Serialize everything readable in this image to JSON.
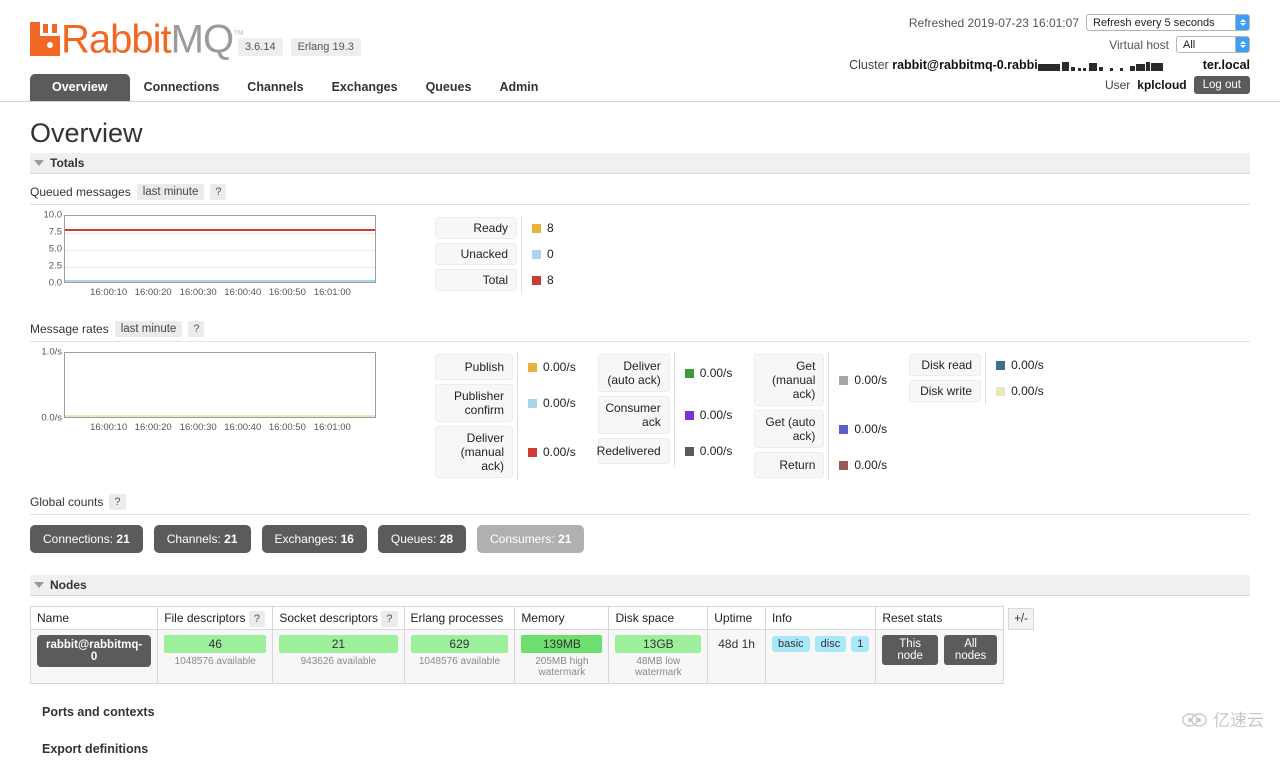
{
  "header": {
    "logo_text_primary": "Rabbit",
    "logo_text_secondary": "MQ",
    "logo_tm": "™",
    "version": "3.6.14",
    "erlang": "Erlang 19.3",
    "refreshed_label": "Refreshed 2019-07-23 16:01:07",
    "refresh_select_value": "Refresh every 5 seconds",
    "vhost_label": "Virtual host",
    "vhost_select_value": "All",
    "cluster_label": "Cluster",
    "cluster_name_prefix": "rabbit@rabbitmq-0.rabbi",
    "cluster_name_suffix": "ter.local",
    "user_label": "User",
    "user_name": "kplcloud",
    "logout_label": "Log out"
  },
  "nav": {
    "tabs": [
      {
        "label": "Overview",
        "active": true
      },
      {
        "label": "Connections",
        "active": false
      },
      {
        "label": "Channels",
        "active": false
      },
      {
        "label": "Exchanges",
        "active": false
      },
      {
        "label": "Queues",
        "active": false
      },
      {
        "label": "Admin",
        "active": false
      }
    ]
  },
  "page": {
    "title": "Overview",
    "totals_section_label": "Totals",
    "nodes_section_label": "Nodes",
    "ports_section_label": "Ports and contexts",
    "export_section_label": "Export definitions"
  },
  "queued_messages": {
    "title": "Queued messages",
    "range_chip": "last minute",
    "help": "?",
    "legend": [
      {
        "label": "Ready",
        "value": "8",
        "color": "#e5b53a"
      },
      {
        "label": "Unacked",
        "value": "0",
        "color": "#a8d6ec"
      },
      {
        "label": "Total",
        "value": "8",
        "color": "#cc3b36"
      }
    ]
  },
  "message_rates": {
    "title": "Message rates",
    "range_chip": "last minute",
    "help": "?",
    "columns": [
      {
        "items": [
          {
            "label": "Publish",
            "value": "0.00/s",
            "color": "#e5b53a"
          },
          {
            "label": "Publisher\nconfirm",
            "value": "0.00/s",
            "color": "#a8d6ec"
          },
          {
            "label": "Deliver\n(manual\nack)",
            "value": "0.00/s",
            "color": "#cc3b36"
          }
        ]
      },
      {
        "items": [
          {
            "label": "Deliver\n(auto ack)",
            "value": "0.00/s",
            "color": "#3c9a3c"
          },
          {
            "label": "Consumer\nack",
            "value": "0.00/s",
            "color": "#7b2fe0"
          },
          {
            "label": "Redelivered",
            "value": "0.00/s",
            "color": "#5a5a5a"
          }
        ]
      },
      {
        "items": [
          {
            "label": "Get\n(manual\nack)",
            "value": "0.00/s",
            "color": "#a7a7a7"
          },
          {
            "label": "Get (auto\nack)",
            "value": "0.00/s",
            "color": "#5b5fc7"
          },
          {
            "label": "Return",
            "value": "0.00/s",
            "color": "#9b5a56"
          }
        ]
      },
      {
        "items": [
          {
            "label": "Disk read",
            "value": "0.00/s",
            "color": "#3f6f8f"
          },
          {
            "label": "Disk write",
            "value": "0.00/s",
            "color": "#ece6bb"
          }
        ]
      }
    ]
  },
  "global_counts": {
    "title": "Global counts",
    "help": "?",
    "items": [
      {
        "label": "Connections:",
        "value": "21",
        "muted": false
      },
      {
        "label": "Channels:",
        "value": "21",
        "muted": false
      },
      {
        "label": "Exchanges:",
        "value": "16",
        "muted": false
      },
      {
        "label": "Queues:",
        "value": "28",
        "muted": false
      },
      {
        "label": "Consumers:",
        "value": "21",
        "muted": true
      }
    ]
  },
  "nodes": {
    "headers": [
      {
        "label": "Name",
        "help": ""
      },
      {
        "label": "File descriptors",
        "help": "?"
      },
      {
        "label": "Socket descriptors",
        "help": "?"
      },
      {
        "label": "Erlang processes",
        "help": ""
      },
      {
        "label": "Memory",
        "help": ""
      },
      {
        "label": "Disk space",
        "help": ""
      },
      {
        "label": "Uptime",
        "help": ""
      },
      {
        "label": "Info",
        "help": ""
      },
      {
        "label": "Reset stats",
        "help": ""
      }
    ],
    "toggle_columns_label": "+/-",
    "row": {
      "name": "rabbit@rabbitmq-0",
      "file_descriptors": {
        "value": "46",
        "note": "1048576 available"
      },
      "socket_descriptors": {
        "value": "21",
        "note": "943626 available"
      },
      "erlang_processes": {
        "value": "629",
        "note": "1048576 available"
      },
      "memory": {
        "value": "139MB",
        "note": "205MB high watermark"
      },
      "disk_space": {
        "value": "13GB",
        "note": "48MB low watermark"
      },
      "uptime": "48d 1h",
      "info_tags": [
        "basic",
        "disc",
        "1"
      ],
      "reset_buttons": [
        "This node",
        "All nodes"
      ]
    }
  },
  "watermark": {
    "text": "亿速云"
  },
  "chart_data": [
    {
      "type": "line",
      "title": "Queued messages",
      "xlabel": "",
      "ylabel": "",
      "ylim": [
        0,
        10
      ],
      "yticks": [
        0.0,
        2.5,
        5.0,
        7.5,
        10.0
      ],
      "ytick_labels": [
        "0.0",
        "2.5",
        "5.0",
        "7.5",
        "10.0"
      ],
      "xticks": [
        "16:00:10",
        "16:00:20",
        "16:00:30",
        "16:00:40",
        "16:00:50",
        "16:01:00"
      ],
      "grid": true,
      "legend_position": "right",
      "series": [
        {
          "name": "Ready",
          "color": "#e5b53a",
          "values": [
            8,
            8,
            8,
            8,
            8,
            8,
            8
          ]
        },
        {
          "name": "Unacked",
          "color": "#a8d6ec",
          "values": [
            0,
            0,
            0,
            0,
            0,
            0,
            0
          ]
        },
        {
          "name": "Total",
          "color": "#cc3b36",
          "values": [
            8,
            8,
            8,
            8,
            8,
            8,
            8
          ]
        }
      ]
    },
    {
      "type": "line",
      "title": "Message rates",
      "xlabel": "",
      "ylabel": "",
      "ylim": [
        0,
        1
      ],
      "yticks": [
        0.0,
        1.0
      ],
      "ytick_labels": [
        "0.0/s",
        "1.0/s"
      ],
      "xticks": [
        "16:00:10",
        "16:00:20",
        "16:00:30",
        "16:00:40",
        "16:00:50",
        "16:01:00"
      ],
      "grid": false,
      "legend_position": "right",
      "series": [
        {
          "name": "Publish",
          "color": "#e5b53a",
          "values": [
            0,
            0,
            0,
            0,
            0,
            0,
            0
          ]
        },
        {
          "name": "Publisher confirm",
          "color": "#a8d6ec",
          "values": [
            0,
            0,
            0,
            0,
            0,
            0,
            0
          ]
        },
        {
          "name": "Deliver (manual ack)",
          "color": "#cc3b36",
          "values": [
            0,
            0,
            0,
            0,
            0,
            0,
            0
          ]
        },
        {
          "name": "Deliver (auto ack)",
          "color": "#3c9a3c",
          "values": [
            0,
            0,
            0,
            0,
            0,
            0,
            0
          ]
        },
        {
          "name": "Consumer ack",
          "color": "#7b2fe0",
          "values": [
            0,
            0,
            0,
            0,
            0,
            0,
            0
          ]
        },
        {
          "name": "Redelivered",
          "color": "#5a5a5a",
          "values": [
            0,
            0,
            0,
            0,
            0,
            0,
            0
          ]
        },
        {
          "name": "Get (manual ack)",
          "color": "#a7a7a7",
          "values": [
            0,
            0,
            0,
            0,
            0,
            0,
            0
          ]
        },
        {
          "name": "Get (auto ack)",
          "color": "#5b5fc7",
          "values": [
            0,
            0,
            0,
            0,
            0,
            0,
            0
          ]
        },
        {
          "name": "Return",
          "color": "#9b5a56",
          "values": [
            0,
            0,
            0,
            0,
            0,
            0,
            0
          ]
        },
        {
          "name": "Disk read",
          "color": "#3f6f8f",
          "values": [
            0,
            0,
            0,
            0,
            0,
            0,
            0
          ]
        },
        {
          "name": "Disk write",
          "color": "#ece6bb",
          "values": [
            0,
            0,
            0,
            0,
            0,
            0,
            0
          ]
        }
      ]
    }
  ]
}
